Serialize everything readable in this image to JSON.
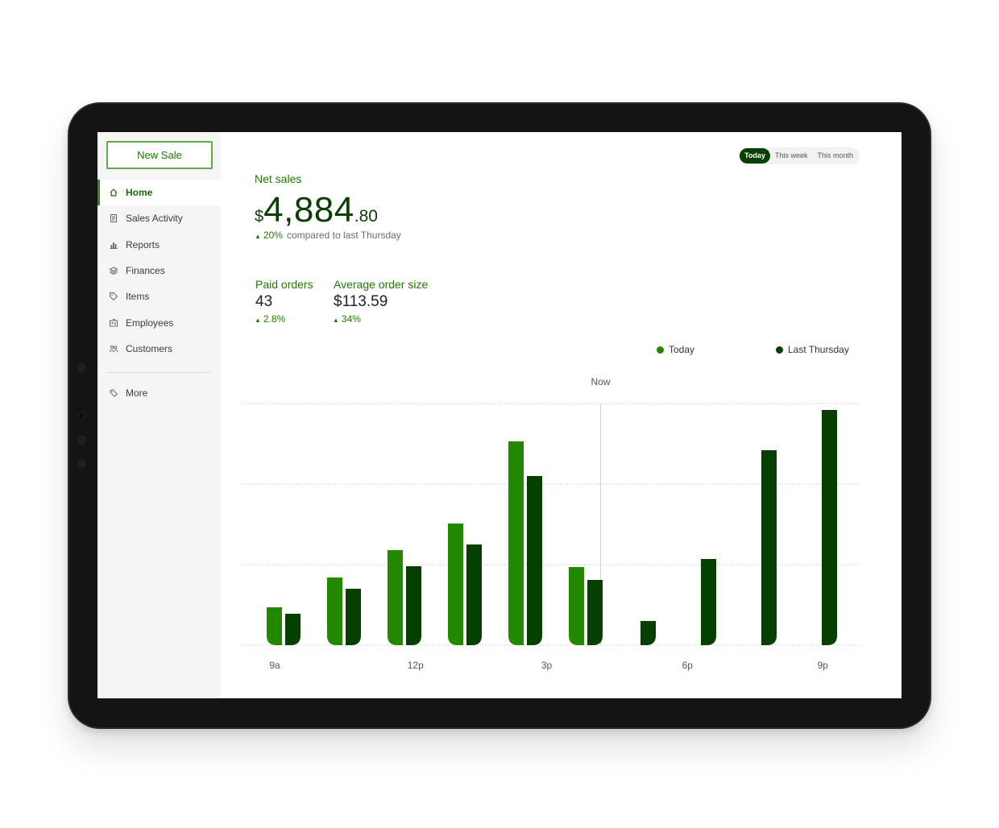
{
  "sidebar": {
    "new_sale_label": "New Sale",
    "items": [
      {
        "label": "Home",
        "icon": "home-icon",
        "active": true
      },
      {
        "label": "Sales Activity",
        "icon": "receipt-icon"
      },
      {
        "label": "Reports",
        "icon": "bar-chart-icon"
      },
      {
        "label": "Finances",
        "icon": "stack-icon"
      },
      {
        "label": "Items",
        "icon": "tag-icon"
      },
      {
        "label": "Employees",
        "icon": "id-card-icon"
      },
      {
        "label": "Customers",
        "icon": "people-icon"
      }
    ],
    "more": {
      "label": "More",
      "icon": "more-icon"
    }
  },
  "range_tabs": {
    "today": "Today",
    "week": "This week",
    "month": "This month",
    "selected": "Today"
  },
  "net_sales": {
    "label": "Net sales",
    "currency": "$",
    "whole": "4,884",
    "cents": ".80",
    "delta": "20%",
    "compare_text": "compared to last Thursday"
  },
  "paid_orders": {
    "label": "Paid orders",
    "value": "43",
    "delta": "2.8%"
  },
  "avg_order": {
    "label": "Average order size",
    "value": "$113.59",
    "delta": "34%"
  },
  "colors": {
    "today": "#228800",
    "last_thursday": "#064000",
    "accent": "#1f7a00"
  },
  "chart_data": {
    "type": "bar",
    "legend": [
      "Today",
      "Last Thursday"
    ],
    "marker_label": "Now",
    "marker_slot": 5.5,
    "x_ticks": [
      {
        "slot": 0,
        "label": "9a"
      },
      {
        "slot": 2.33,
        "label": "12p"
      },
      {
        "slot": 4.5,
        "label": "3p"
      },
      {
        "slot": 6.83,
        "label": "6p"
      },
      {
        "slot": 9.07,
        "label": "9p"
      }
    ],
    "ylim": [
      0,
      300
    ],
    "grid": true,
    "series": [
      {
        "name": "Today",
        "values": [
          47,
          84,
          118,
          151,
          253,
          97,
          null,
          null,
          null,
          null
        ]
      },
      {
        "name": "Last Thursday",
        "values": [
          39,
          70,
          98,
          125,
          210,
          81,
          30,
          107,
          242,
          292
        ]
      }
    ]
  }
}
